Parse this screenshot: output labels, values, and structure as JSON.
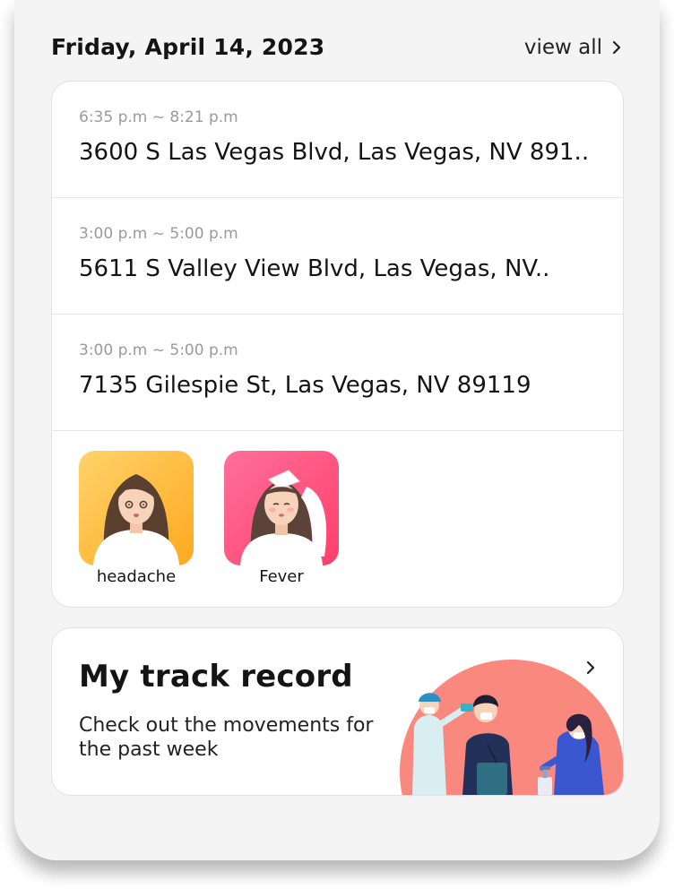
{
  "header": {
    "date": "Friday, April 14, 2023",
    "view_all_label": "view all"
  },
  "visits": [
    {
      "time": "6:35 p.m ~ 8:21 p.m",
      "address": "3600 S Las Vegas Blvd, Las Vegas, NV 891.."
    },
    {
      "time": "3:00 p.m ~ 5:00 p.m",
      "address": "5611 S Valley View Blvd, Las Vegas, NV.."
    },
    {
      "time": "3:00 p.m ~ 5:00 p.m",
      "address": "7135 Gilespie St, Las Vegas, NV 89119"
    }
  ],
  "symptoms": [
    {
      "label": "headache",
      "icon": "headache-avatar-icon",
      "color": "#ffb636"
    },
    {
      "label": "Fever",
      "icon": "fever-avatar-icon",
      "color": "#ff4f7b"
    }
  ],
  "track_record": {
    "title": "My track record",
    "description": "Check out the movements for the past week",
    "illustration": "temperature-check-illustration",
    "accent": "#f9897e"
  }
}
